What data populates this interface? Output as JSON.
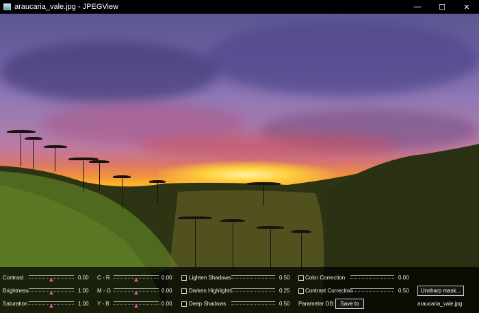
{
  "window": {
    "title": "araucaria_vale.jpg - JPEGView",
    "controls": {
      "minimize": "—",
      "maximize": "☐",
      "close": "✕"
    }
  },
  "panel": {
    "col1": [
      {
        "label": "Contrast",
        "value": "0.00",
        "level": 0.5
      },
      {
        "label": "Brightness",
        "value": "1.00",
        "level": 0.5
      },
      {
        "label": "Saturation",
        "value": "1.00",
        "level": 0.5
      }
    ],
    "col2": [
      {
        "label": "C - R",
        "value": "0.00",
        "level": 0.5
      },
      {
        "label": "M - G",
        "value": "0.00",
        "level": 0.5
      },
      {
        "label": "Y - B",
        "value": "0.00",
        "level": 0.5
      }
    ],
    "col3": [
      {
        "label": "Lighten Shadows",
        "value": "0.50",
        "checked": false
      },
      {
        "label": "Darken Highlights",
        "value": "0.25",
        "checked": false
      },
      {
        "label": "Deep Shadows",
        "value": "0.50",
        "checked": false
      }
    ],
    "col4": [
      {
        "label": "Color Correction",
        "value": "0.00",
        "checked": false
      },
      {
        "label": "Contrast Correction",
        "value": "0.50",
        "checked": false
      }
    ],
    "param_db_label": "Parameter DB:",
    "save_label": "Save to",
    "unsharp_label": "Unsharp mask...",
    "filename": "araucaria_vale.jpg"
  }
}
